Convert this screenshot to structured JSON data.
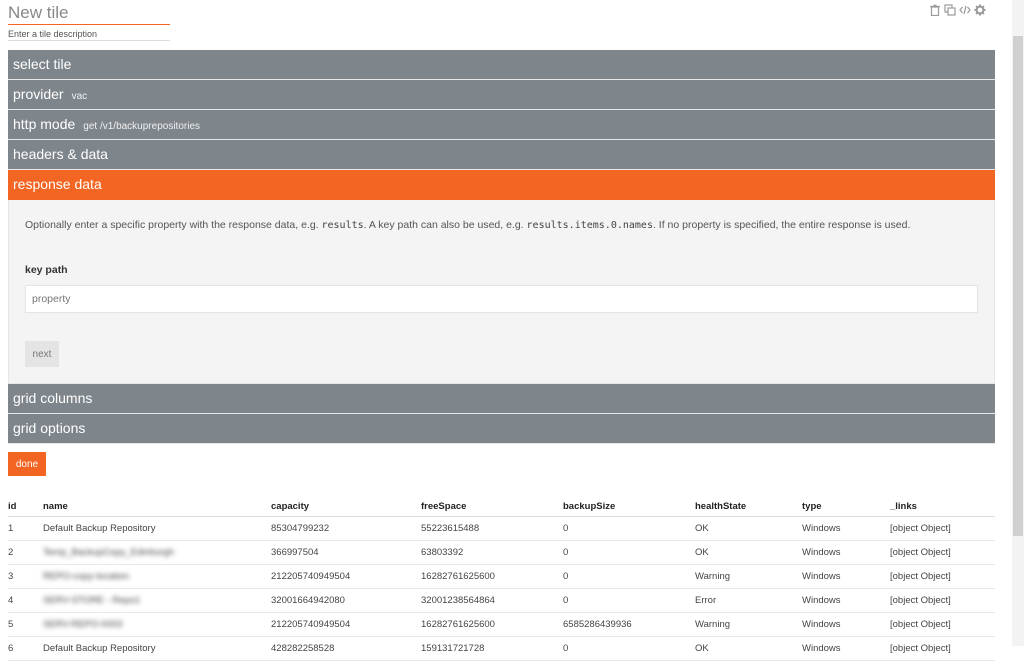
{
  "tile": {
    "title": "New tile",
    "description": "Enter a tile description"
  },
  "toolbar": {
    "icons": [
      "trash-icon",
      "copy-icon",
      "code-icon",
      "gear-icon"
    ]
  },
  "accordion": {
    "select_tile": "select tile",
    "provider_label": "provider",
    "provider_value": "vac",
    "http_mode_label": "http mode",
    "http_mode_value": "get /v1/backuprepositories",
    "headers_data": "headers & data",
    "response_data": "response data",
    "grid_columns": "grid columns",
    "grid_options": "grid options"
  },
  "response": {
    "help_1": "Optionally enter a specific property with the response data, e.g. ",
    "code_1": "results",
    "help_2": ". A key path can also be used, e.g. ",
    "code_2": "results.items.0.names",
    "help_3": ". If no property is specified, the entire response is used.",
    "key_path_label": "key path",
    "key_path_placeholder": "property",
    "next_label": "next"
  },
  "done_label": "done",
  "grid": {
    "columns": [
      "id",
      "name",
      "capacity",
      "freeSpace",
      "backupSize",
      "healthState",
      "type",
      "_links"
    ],
    "rows": [
      [
        "1",
        "Default Backup Repository",
        "85304799232",
        "55223615488",
        "0",
        "OK",
        "Windows",
        "[object Object]"
      ],
      [
        "2",
        "Temp_BackupCopy_Edinburgh",
        "366997504",
        "63803392",
        "0",
        "OK",
        "Windows",
        "[object Object]"
      ],
      [
        "3",
        "REPO-copy-location",
        "212205740949504",
        "16282761625600",
        "0",
        "Warning",
        "Windows",
        "[object Object]"
      ],
      [
        "4",
        "SERV-STORE - Repo1",
        "32001664942080",
        "32001238564864",
        "0",
        "Error",
        "Windows",
        "[object Object]"
      ],
      [
        "5",
        "SERV-REPO-0003",
        "212205740949504",
        "16282761625600",
        "6585286439936",
        "Warning",
        "Windows",
        "[object Object]"
      ],
      [
        "6",
        "Default Backup Repository",
        "428282258528",
        "159131721728",
        "0",
        "OK",
        "Windows",
        "[object Object]"
      ]
    ]
  }
}
